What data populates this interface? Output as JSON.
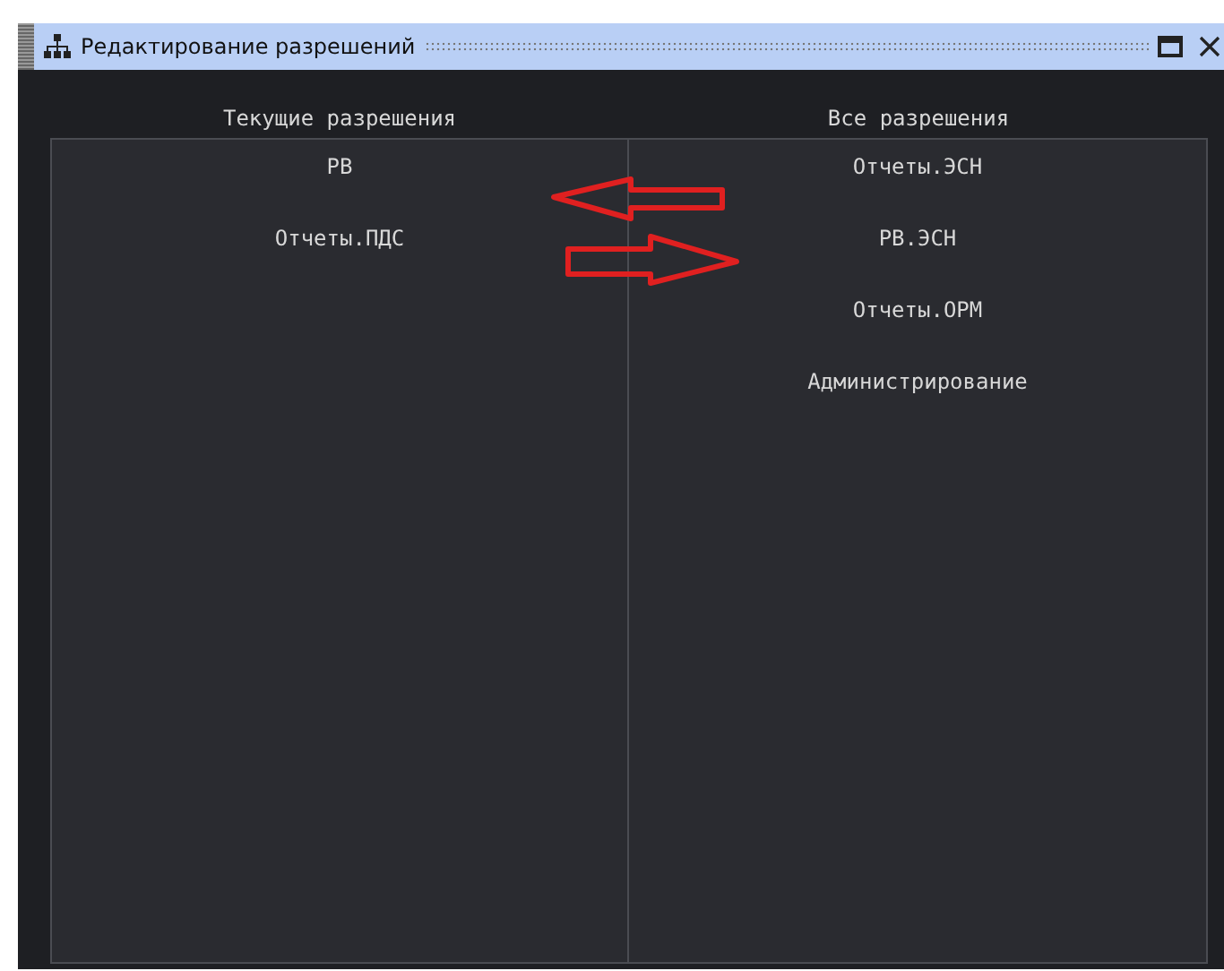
{
  "window": {
    "title": "Редактирование разрешений"
  },
  "current_permissions": {
    "heading": "Текущие разрешения",
    "items": [
      "РВ",
      "Отчеты.ПДС"
    ]
  },
  "all_permissions": {
    "heading": "Все разрешения",
    "items": [
      "Отчеты.ЭСН",
      "РВ.ЭСН",
      "Отчеты.ОРМ",
      "Администрирование"
    ]
  }
}
